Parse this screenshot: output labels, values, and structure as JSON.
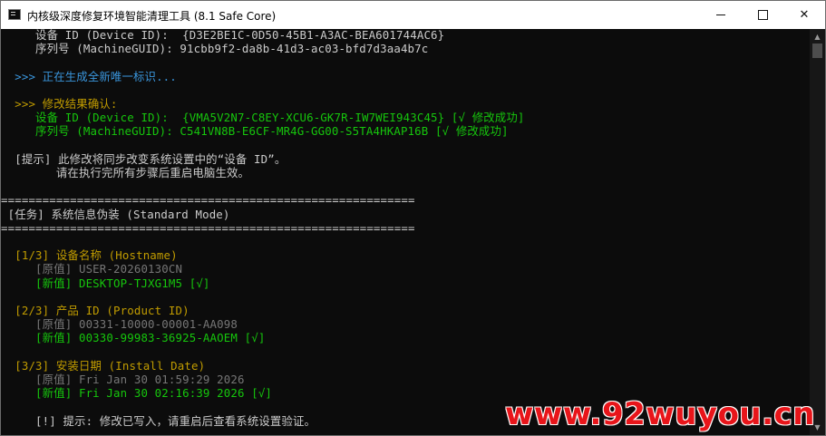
{
  "window": {
    "title": "内核级深度修复环境智能清理工具 (8.1 Safe Core)",
    "controls": {
      "minimize": "—",
      "maximize": "□",
      "close": "✕"
    }
  },
  "console": {
    "lines": [
      {
        "text": "     设备 ID (Device ID):  {D3E2BE1C-0D50-45B1-A3AC-BEA601744AC6}",
        "color": "#cccccc"
      },
      {
        "text": "     序列号 (MachineGUID): 91cbb9f2-da8b-41d3-ac03-bfd7d3aa4b7c",
        "color": "#cccccc"
      },
      {
        "text": "",
        "color": "#cccccc"
      },
      {
        "text": "  >>> 正在生成全新唯一标识...",
        "color": "#3a96dd"
      },
      {
        "text": "",
        "color": "#cccccc"
      },
      {
        "text": "  >>> 修改结果确认:",
        "color": "#c19c00"
      },
      {
        "text": "     设备 ID (Device ID):  {VMA5V2N7-C8EY-XCU6-GK7R-IW7WEI943C45} [√ 修改成功]",
        "color": "#16c60c"
      },
      {
        "text": "     序列号 (MachineGUID): C541VN8B-E6CF-MR4G-GG00-S5TA4HKAP16B [√ 修改成功]",
        "color": "#16c60c"
      },
      {
        "text": "",
        "color": "#cccccc"
      },
      {
        "text": "  [提示] 此修改将同步改变系统设置中的“设备 ID”。",
        "color": "#cccccc"
      },
      {
        "text": "        请在执行完所有步骤后重启电脑生效。",
        "color": "#cccccc"
      },
      {
        "text": "",
        "color": "#cccccc"
      },
      {
        "text": "============================================================",
        "color": "#cccccc"
      },
      {
        "text": " [任务] 系统信息伪装 (Standard Mode)",
        "color": "#cccccc"
      },
      {
        "text": "============================================================",
        "color": "#cccccc"
      },
      {
        "text": "",
        "color": "#cccccc"
      },
      {
        "text": "  [1/3] 设备名称 (Hostname)",
        "color": "#c19c00"
      },
      {
        "text": "     [原值] USER-20260130CN",
        "color": "#767676"
      },
      {
        "text": "     [新值] DESKTOP-TJXG1M5 [√]",
        "color": "#16c60c"
      },
      {
        "text": "",
        "color": "#cccccc"
      },
      {
        "text": "  [2/3] 产品 ID (Product ID)",
        "color": "#c19c00"
      },
      {
        "text": "     [原值] 00331-10000-00001-AA098",
        "color": "#767676"
      },
      {
        "text": "     [新值] 00330-99983-36925-AAOEM [√]",
        "color": "#16c60c"
      },
      {
        "text": "",
        "color": "#cccccc"
      },
      {
        "text": "  [3/3] 安装日期 (Install Date)",
        "color": "#c19c00"
      },
      {
        "text": "     [原值] Fri Jan 30 01:59:29 2026",
        "color": "#767676"
      },
      {
        "text": "     [新值] Fri Jan 30 02:16:39 2026 [√]",
        "color": "#16c60c"
      },
      {
        "text": "",
        "color": "#cccccc"
      },
      {
        "text": "     [!] 提示: 修改已写入，请重启后查看系统设置验证。",
        "color": "#cccccc"
      }
    ]
  },
  "scrollbar": {
    "up": "▲",
    "down": "▼"
  },
  "watermark": {
    "text": "www.92wuyou.cn",
    "color": "#e8151a"
  }
}
